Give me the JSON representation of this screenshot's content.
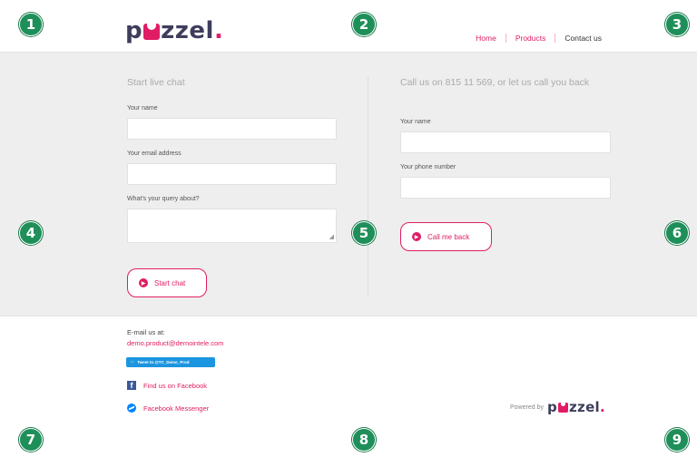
{
  "header": {
    "logo": {
      "pre": "p",
      "post": "zzel",
      "dot": "."
    },
    "nav": [
      {
        "label": "Home"
      },
      {
        "label": "Products"
      },
      {
        "label": "Contact us"
      }
    ]
  },
  "markers": [
    "1",
    "2",
    "3",
    "4",
    "5",
    "6",
    "7",
    "8",
    "9"
  ],
  "chat": {
    "title": "Start live chat",
    "name_label": "Your name",
    "email_label": "Your email address",
    "query_label": "What's your query about?",
    "button_label": "Start chat"
  },
  "callback": {
    "title": "Call us on 815 11 569, or let us call you back",
    "name_label": "Your name",
    "phone_label": "Your phone number",
    "button_label": "Call me back"
  },
  "footer": {
    "email_label": "E-mail us at:",
    "email_address": "demo.product@demointele.com",
    "tweet_label": "Tweet to @TC_Demo_Prod",
    "facebook_label": "Find us on Facebook",
    "messenger_label": "Facebook Messenger",
    "powered_by": "Powered by"
  },
  "colors": {
    "accent": "#e01c64",
    "marker": "#1f8f5a",
    "band": "#eeeeee",
    "facebook": "#3b5998",
    "twitter": "#1b95e0",
    "messenger": "#0084ff"
  }
}
